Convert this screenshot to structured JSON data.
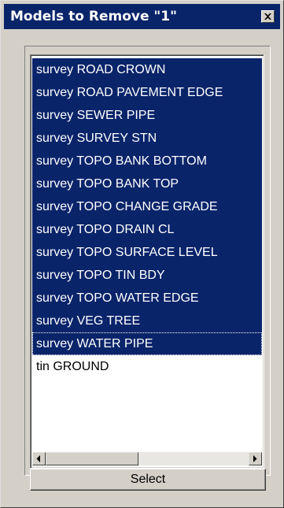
{
  "window": {
    "title": "Models to Remove \"1\""
  },
  "listbox": {
    "items": [
      {
        "label": "survey ROAD CROWN",
        "selected": true
      },
      {
        "label": "survey ROAD PAVEMENT EDGE",
        "selected": true
      },
      {
        "label": "survey SEWER PIPE",
        "selected": true
      },
      {
        "label": "survey SURVEY STN",
        "selected": true
      },
      {
        "label": "survey TOPO BANK BOTTOM",
        "selected": true
      },
      {
        "label": "survey TOPO BANK TOP",
        "selected": true
      },
      {
        "label": "survey TOPO CHANGE GRADE",
        "selected": true
      },
      {
        "label": "survey TOPO DRAIN CL",
        "selected": true
      },
      {
        "label": "survey TOPO SURFACE LEVEL",
        "selected": true
      },
      {
        "label": "survey TOPO TIN BDY",
        "selected": true
      },
      {
        "label": "survey TOPO WATER EDGE",
        "selected": true
      },
      {
        "label": "survey VEG TREE",
        "selected": true
      },
      {
        "label": "survey WATER PIPE",
        "selected": true,
        "focused": true
      },
      {
        "label": "tin GROUND",
        "selected": false
      }
    ]
  },
  "buttons": {
    "select_label": "Select"
  },
  "colors": {
    "selection": "#0a246a",
    "titlebar": "#0a246a",
    "face": "#d4d0c8"
  },
  "icons": {
    "close": "close-icon",
    "scroll_left": "arrow-left-icon",
    "scroll_right": "arrow-right-icon"
  }
}
